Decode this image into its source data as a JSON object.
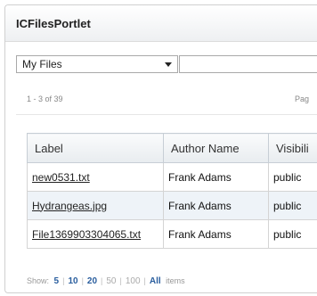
{
  "portlet": {
    "title": "ICFilesPortlet"
  },
  "filter": {
    "selected": "My Files",
    "search_value": ""
  },
  "paging": {
    "range": "1 - 3 of 39",
    "page_label": "Pag"
  },
  "table": {
    "headers": [
      "Label",
      "Author Name",
      "Visibili"
    ],
    "rows": [
      {
        "label": "new0531.txt",
        "author": "Frank Adams",
        "visibility": "public"
      },
      {
        "label": "Hydrangeas.jpg",
        "author": "Frank Adams",
        "visibility": "public"
      },
      {
        "label": "File1369903304065.txt",
        "author": "Frank Adams",
        "visibility": "public"
      }
    ]
  },
  "pager": {
    "show_label": "Show:",
    "sizes": [
      "5",
      "10",
      "20",
      "50",
      "100"
    ],
    "all_label": "All",
    "items_label": "items"
  },
  "colors": {
    "link_blue": "#2a5e9e",
    "row_alt": "#eef3f8"
  }
}
